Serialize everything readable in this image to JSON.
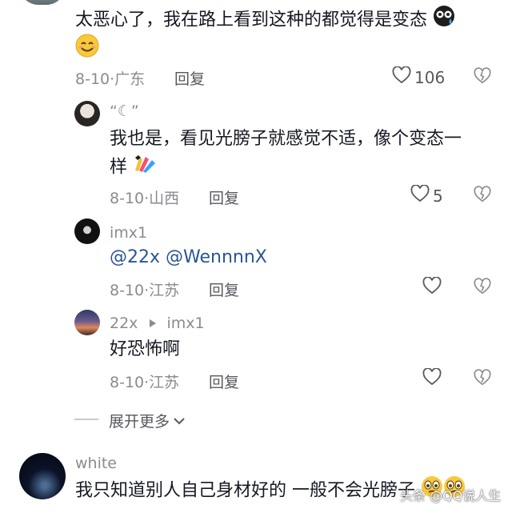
{
  "comments": [
    {
      "text": "太恶心了，我在路上看到这种的都觉得是变态",
      "date": "8-10",
      "region": "广东",
      "reply_label": "回复",
      "likes": "106"
    },
    {
      "username": "“☾”",
      "text_line1": "我也是，看见光膀子就感觉不适，像个变态一",
      "text_line2": "样",
      "date": "8-10",
      "region": "山西",
      "reply_label": "回复",
      "likes": "5"
    },
    {
      "username": "imx1",
      "text": "@22x @WennnnX",
      "date": "8-10",
      "region": "江苏",
      "reply_label": "回复"
    },
    {
      "username": "22x",
      "reply_to": "imx1",
      "text": "好恐怖啊",
      "date": "8-10",
      "region": "江苏",
      "reply_label": "回复"
    },
    {
      "username": "white",
      "text": "我只知道别人自己身材好的 一般不会光膀子"
    }
  ],
  "expand_more": "展开更多",
  "separator": "·",
  "watermark": "头条 @QQ说人生",
  "colors": {
    "text": "#161823",
    "meta": "#8a8b91",
    "mention": "#2b5592"
  }
}
